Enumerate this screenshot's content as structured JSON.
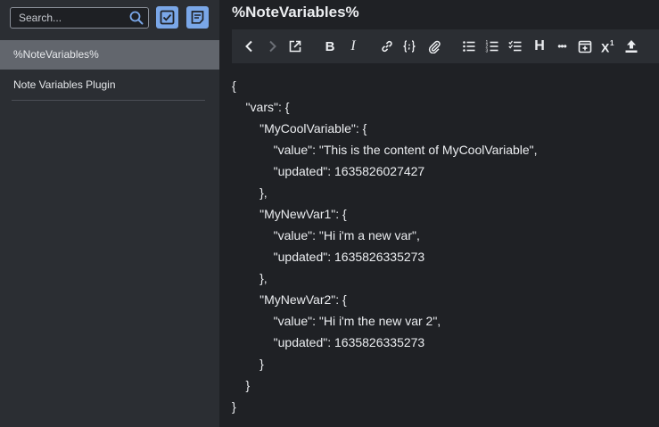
{
  "sidebar": {
    "search": {
      "placeholder": "Search..."
    },
    "notes": [
      {
        "title": "%NoteVariables%"
      },
      {
        "title": "Note Variables Plugin"
      }
    ]
  },
  "editor": {
    "title": "%NoteVariables%",
    "toolbar": {
      "bold_label": "B",
      "italic_label": "I",
      "heading_label": "H",
      "more_label": "•••"
    },
    "content_lines": [
      "{",
      "    \"vars\": {",
      "        \"MyCoolVariable\": {",
      "            \"value\": \"This is the content of MyCoolVariable\",",
      "            \"updated\": 1635826027427",
      "        },",
      "        \"MyNewVar1\": {",
      "            \"value\": \"Hi i'm a new var\",",
      "            \"updated\": 1635826335273",
      "        },",
      "        \"MyNewVar2\": {",
      "            \"value\": \"Hi i'm the new var 2\",",
      "            \"updated\": 1635826335273",
      "        }",
      "    }",
      "}"
    ]
  },
  "colors": {
    "accent": "#7aa7e8",
    "sidebar_bg": "#2b2e33",
    "selected_bg": "#62666d",
    "editor_bg": "#1f2125"
  }
}
